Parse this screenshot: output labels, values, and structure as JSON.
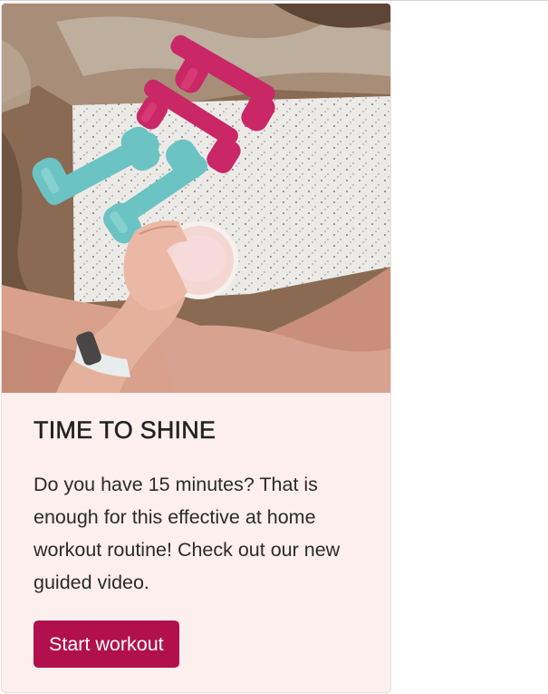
{
  "card": {
    "title": "TIME TO SHINE",
    "text": "Do you have 15 minutes? That is enough for this effective at home workout routine! Check out our new guided video.",
    "button_label": "Start workout",
    "background_color": "#fdefee",
    "button_color": "#b1104d"
  }
}
